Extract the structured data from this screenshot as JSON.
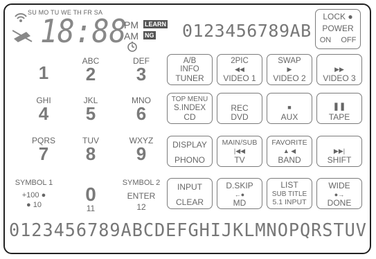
{
  "display": {
    "days": "SU MO TU WE TH FR SA",
    "clock": "18:88",
    "pm": "PM",
    "am": "AM",
    "learn": "LEARN",
    "ng": "NG",
    "hex_row": "0123456789AB",
    "bottom_row": "0123456789ABCDEFGHIJKLMNOPQRSTUV"
  },
  "lock_box": {
    "lock": "LOCK",
    "power": "POWER",
    "on": "ON",
    "off": "OFF"
  },
  "keypad": [
    {
      "sub": "",
      "num": "1"
    },
    {
      "sub": "ABC",
      "num": "2"
    },
    {
      "sub": "DEF",
      "num": "3"
    },
    {
      "sub": "GHI",
      "num": "4"
    },
    {
      "sub": "JKL",
      "num": "5"
    },
    {
      "sub": "MNO",
      "num": "6"
    },
    {
      "sub": "PQRS",
      "num": "7"
    },
    {
      "sub": "TUV",
      "num": "8"
    },
    {
      "sub": "WXYZ",
      "num": "9"
    }
  ],
  "bottom_keys": {
    "symbol1": "SYMBOL 1",
    "plus100": "+100",
    "ten": "10",
    "zero": "0",
    "eleven": "11",
    "symbol2": "SYMBOL 2",
    "enter": "ENTER",
    "twelve": "12"
  },
  "buttons": {
    "ab": [
      "A/B",
      "INFO",
      "TUNER"
    ],
    "pic2": [
      "2PIC",
      "VIDEO 1"
    ],
    "swap": [
      "SWAP",
      "VIDEO 2"
    ],
    "video3": [
      "VIDEO 3"
    ],
    "topmenu": [
      "TOP MENU",
      "S.INDEX",
      "CD"
    ],
    "rec": [
      "REC",
      "DVD"
    ],
    "aux": [
      "AUX"
    ],
    "tape": [
      "TAPE"
    ],
    "display": [
      "DISPLAY",
      "PHONO"
    ],
    "mainsub": [
      "MAIN/SUB",
      "TV"
    ],
    "favorite": [
      "FAVORITE",
      "BAND"
    ],
    "shift": [
      "SHIFT"
    ],
    "input": [
      "INPUT",
      "CLEAR"
    ],
    "dskip": [
      "D.SKIP",
      "MD"
    ],
    "list": [
      "LIST",
      "SUB TITLE",
      "5.1 INPUT"
    ],
    "wide": [
      "WIDE",
      "DONE"
    ]
  }
}
